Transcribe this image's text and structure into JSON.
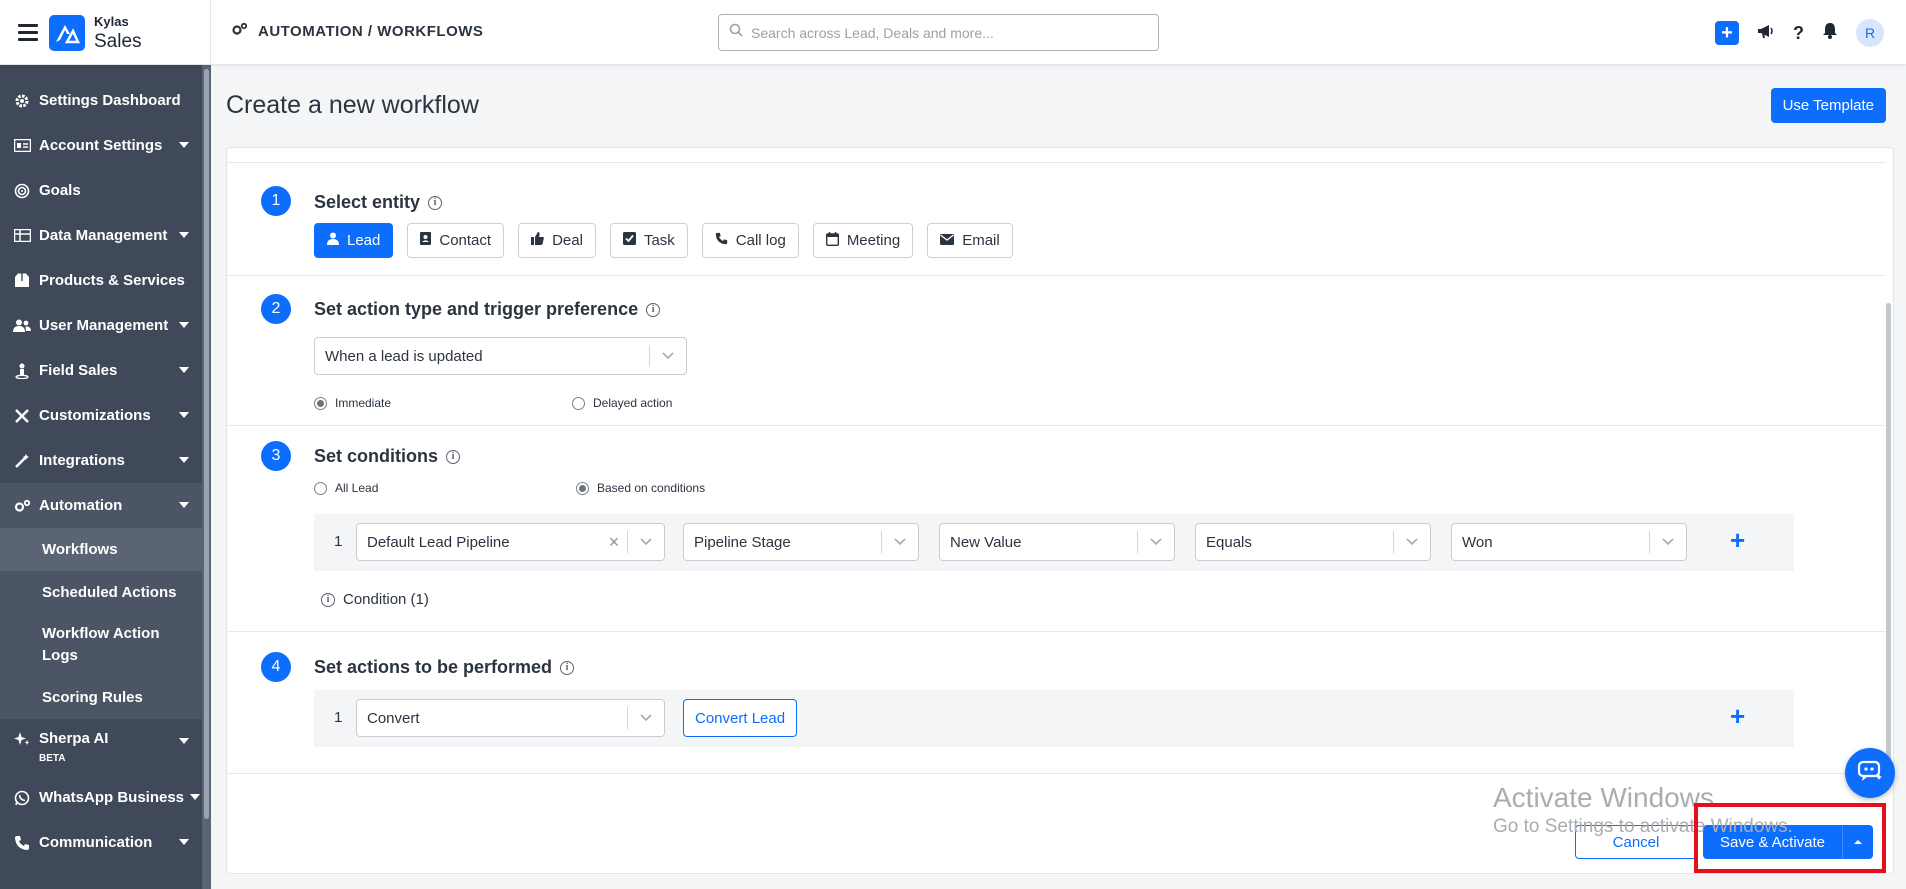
{
  "brand": {
    "top": "Kylas",
    "bottom": "Sales"
  },
  "breadcrumb": "AUTOMATION / WORKFLOWS",
  "search": {
    "placeholder": "Search across Lead, Deals and more..."
  },
  "user": {
    "initial": "R"
  },
  "sidebar": {
    "items": [
      {
        "label": "Settings Dashboard",
        "icon": "gear-icon"
      },
      {
        "label": "Account Settings",
        "icon": "id-card-icon",
        "expandable": true
      },
      {
        "label": "Goals",
        "icon": "target-icon"
      },
      {
        "label": "Data Management",
        "icon": "table-icon",
        "expandable": true
      },
      {
        "label": "Products & Services",
        "icon": "box-icon"
      },
      {
        "label": "User Management",
        "icon": "users-icon",
        "expandable": true
      },
      {
        "label": "Field Sales",
        "icon": "person-pin-icon",
        "expandable": true
      },
      {
        "label": "Customizations",
        "icon": "tools-icon",
        "expandable": true
      },
      {
        "label": "Integrations",
        "icon": "wand-icon",
        "expandable": true
      },
      {
        "label": "Automation",
        "icon": "gears-icon",
        "expandable": true,
        "expanded": true
      }
    ],
    "automation_sub": [
      {
        "label": "Workflows",
        "active": true
      },
      {
        "label": "Scheduled Actions"
      },
      {
        "label": "Workflow Action Logs"
      },
      {
        "label": "Scoring Rules"
      }
    ],
    "after": [
      {
        "label": "Sherpa AI",
        "badge": "BETA",
        "icon": "sparkle-icon"
      },
      {
        "label": "WhatsApp Business",
        "icon": "whatsapp-icon"
      },
      {
        "label": "Communication",
        "icon": "phone-icon"
      }
    ]
  },
  "page": {
    "title": "Create a new workflow",
    "use_template": "Use Template"
  },
  "step1": {
    "num": "1",
    "title": "Select entity",
    "entities": [
      {
        "label": "Lead",
        "selected": true
      },
      {
        "label": "Contact"
      },
      {
        "label": "Deal"
      },
      {
        "label": "Task"
      },
      {
        "label": "Call log"
      },
      {
        "label": "Meeting"
      },
      {
        "label": "Email"
      }
    ]
  },
  "step2": {
    "num": "2",
    "title": "Set action type and trigger preference",
    "trigger": "When a lead is updated",
    "radio_immediate": "Immediate",
    "radio_delayed": "Delayed action",
    "selected": "Immediate"
  },
  "step3": {
    "num": "3",
    "title": "Set conditions",
    "radio_all": "All Lead",
    "radio_based": "Based on conditions",
    "selected": "Based on conditions",
    "row": {
      "num": "1",
      "pipeline": "Default Lead Pipeline",
      "field": "Pipeline Stage",
      "value_type": "New Value",
      "operator": "Equals",
      "value": "Won"
    },
    "condition_count": "Condition (1)"
  },
  "step4": {
    "num": "4",
    "title": "Set actions to be performed",
    "row": {
      "num": "1",
      "action": "Convert",
      "action_button": "Convert Lead"
    }
  },
  "footer": {
    "cancel": "Cancel",
    "save": "Save & Activate"
  },
  "watermark": {
    "line1": "Activate Windows",
    "line2": "Go to Settings to activate Windows."
  },
  "colors": {
    "primary": "#0d6efd",
    "sidebar": "#3f4959",
    "highlight": "#e3101c"
  }
}
